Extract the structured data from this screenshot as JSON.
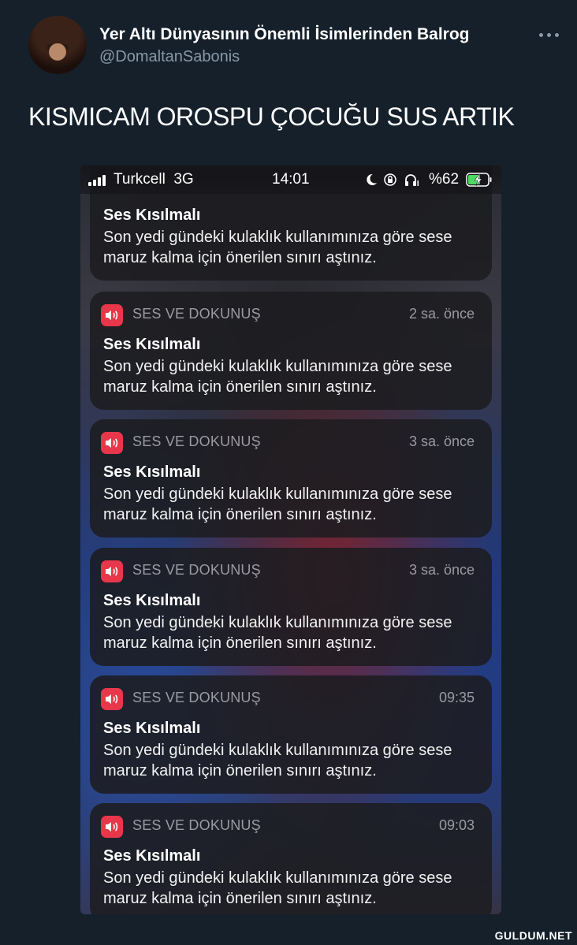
{
  "tweet": {
    "display_name": "Yer Altı Dünyasının Önemli İsimlerinden Balrog",
    "handle": "@DomaltanSabonis",
    "text": "KISMICAM OROSPU ÇOCUĞU SUS ARTIK"
  },
  "status_bar": {
    "carrier": "Turkcell  3G",
    "time": "14:01",
    "battery": "%62"
  },
  "notifications": [
    {
      "app": "",
      "time": "",
      "title": "Ses Kısılmalı",
      "body": "Son yedi gündeki kulaklık kullanımınıza göre sese maruz kalma için önerilen sınırı aştınız."
    },
    {
      "app": "SES VE DOKUNUŞ",
      "time": "2 sa. önce",
      "title": "Ses Kısılmalı",
      "body": "Son yedi gündeki kulaklık kullanımınıza göre sese maruz kalma için önerilen sınırı aştınız."
    },
    {
      "app": "SES VE DOKUNUŞ",
      "time": "3 sa. önce",
      "title": "Ses Kısılmalı",
      "body": "Son yedi gündeki kulaklık kullanımınıza göre sese maruz kalma için önerilen sınırı aştınız."
    },
    {
      "app": "SES VE DOKUNUŞ",
      "time": "3 sa. önce",
      "title": "Ses Kısılmalı",
      "body": "Son yedi gündeki kulaklık kullanımınıza göre sese maruz kalma için önerilen sınırı aştınız."
    },
    {
      "app": "SES VE DOKUNUŞ",
      "time": "09:35",
      "title": "Ses Kısılmalı",
      "body": "Son yedi gündeki kulaklık kullanımınıza göre sese maruz kalma için önerilen sınırı aştınız."
    },
    {
      "app": "SES VE DOKUNUŞ",
      "time": "09:03",
      "title": "Ses Kısılmalı",
      "body": "Son yedi gündeki kulaklık kullanımınıza göre sese maruz kalma için önerilen sınırı aştınız."
    }
  ],
  "icons": {
    "more": "more-horizontal-icon",
    "app": "speaker-icon",
    "status": [
      "signal-icon",
      "moon-icon",
      "rotation-lock-icon",
      "headphones-icon",
      "battery-charging-icon"
    ]
  },
  "colors": {
    "background": "#15202b",
    "handle": "#8899a6",
    "app_icon": "#e8364a"
  },
  "watermark": "GULDUM.NET"
}
